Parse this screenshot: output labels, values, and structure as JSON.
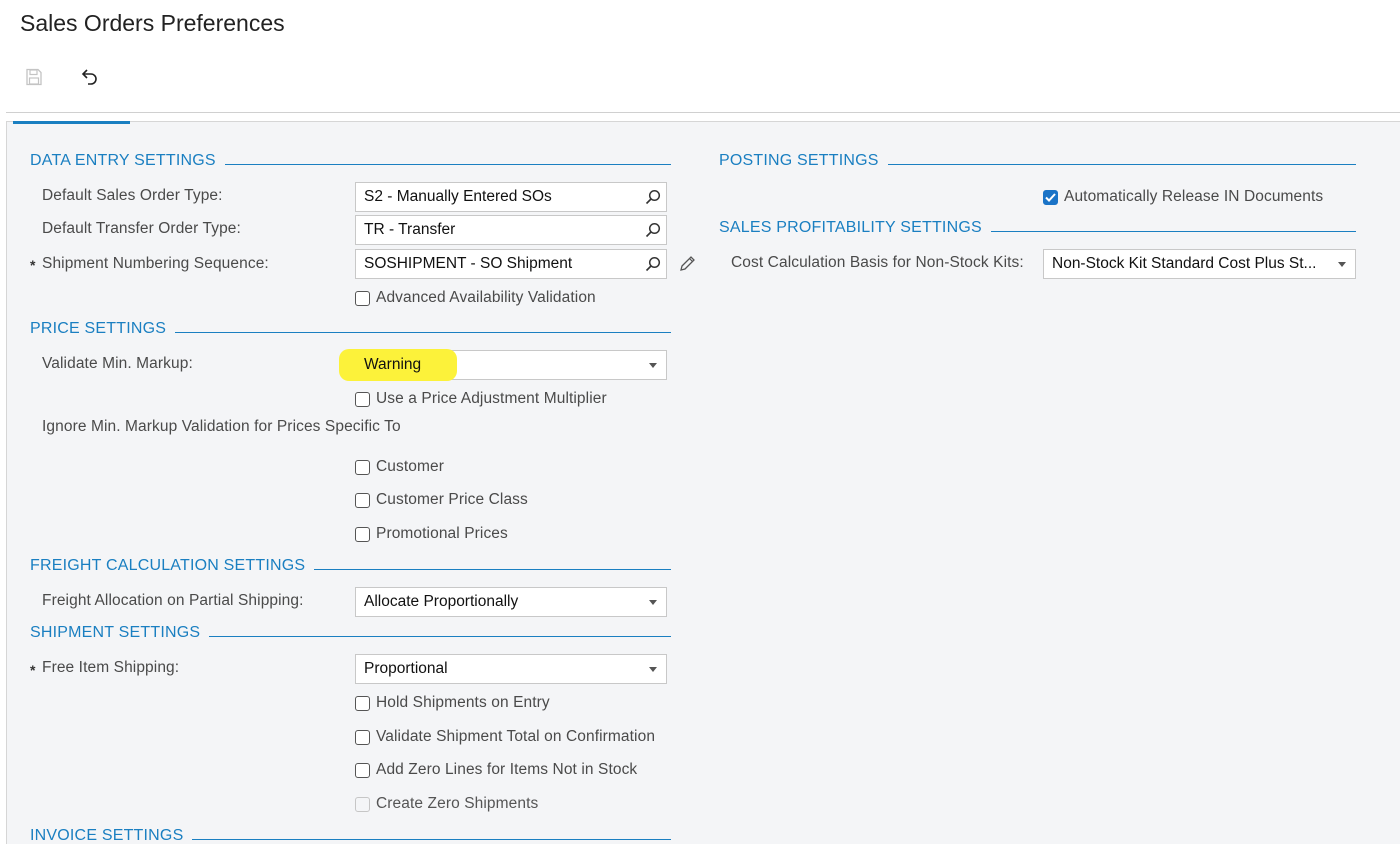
{
  "page": {
    "title": "Sales Orders Preferences"
  },
  "toolbar": {
    "save_icon": "save-icon",
    "undo_icon": "undo-icon"
  },
  "data_entry": {
    "header": "DATA ENTRY SETTINGS",
    "default_sales_order_type_label": "Default Sales Order Type:",
    "default_sales_order_type_value": "S2 - Manually Entered SOs",
    "default_transfer_order_type_label": "Default Transfer Order Type:",
    "default_transfer_order_type_value": "TR - Transfer",
    "required_mark": "*",
    "shipment_numbering_label": "Shipment Numbering Sequence:",
    "shipment_numbering_value": "SOSHIPMENT - SO Shipment",
    "advanced_availability_label": "Advanced Availability Validation",
    "advanced_availability_checked": false
  },
  "price": {
    "header": "PRICE SETTINGS",
    "validate_min_markup_label": "Validate Min. Markup:",
    "validate_min_markup_value": "Warning",
    "highlight_color": "#fcf23a",
    "price_adjustment_label": "Use a Price Adjustment Multiplier",
    "ignore_label": "Ignore Min. Markup Validation for Prices Specific To",
    "customer_label": "Customer",
    "customer_price_class_label": "Customer Price Class",
    "promotional_prices_label": "Promotional Prices"
  },
  "freight": {
    "header": "FREIGHT CALCULATION SETTINGS",
    "allocation_label": "Freight Allocation on Partial Shipping:",
    "allocation_value": "Allocate Proportionally"
  },
  "shipment": {
    "header": "SHIPMENT SETTINGS",
    "required_mark": "*",
    "free_item_label": "Free Item Shipping:",
    "free_item_value": "Proportional",
    "hold_label": "Hold Shipments on Entry",
    "validate_total_label": "Validate Shipment Total on Confirmation",
    "zero_lines_label": "Add Zero Lines for Items Not in Stock",
    "zero_shipments_label": "Create Zero Shipments"
  },
  "invoice": {
    "header": "INVOICE SETTINGS"
  },
  "posting": {
    "header": "POSTING SETTINGS",
    "auto_release_label": "Automatically Release IN Documents",
    "auto_release_checked": true
  },
  "profitability": {
    "header": "SALES PROFITABILITY SETTINGS",
    "cost_basis_label": "Cost Calculation Basis for Non-Stock Kits:",
    "cost_basis_value": "Non-Stock Kit Standard Cost Plus St..."
  },
  "colors": {
    "accent": "#1a7fc1",
    "checkbox_checked": "#1a73c7",
    "background": "#f4f5f7"
  }
}
